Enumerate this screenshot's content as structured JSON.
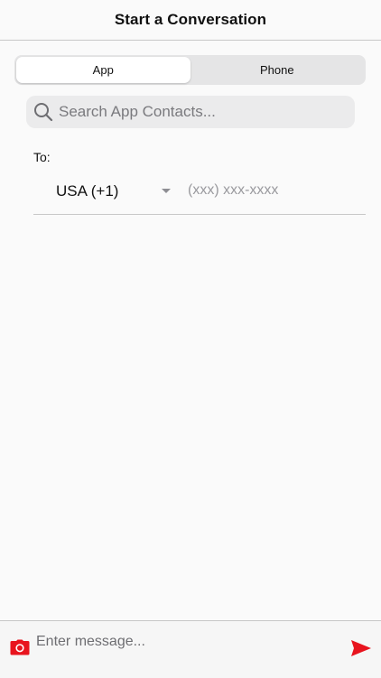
{
  "header": {
    "title": "Start a Conversation"
  },
  "segments": [
    {
      "label": "App",
      "active": true
    },
    {
      "label": "Phone",
      "active": false
    }
  ],
  "search": {
    "placeholder": "Search App Contacts...",
    "icon": "search-icon"
  },
  "recipient": {
    "to_label": "To:",
    "country": "USA (+1)",
    "phone_placeholder": "(xxx) xxx-xxxx"
  },
  "composer": {
    "placeholder": "Enter message...",
    "camera_icon": "camera-icon",
    "send_icon": "send-icon",
    "accent_color": "#e8141e"
  }
}
